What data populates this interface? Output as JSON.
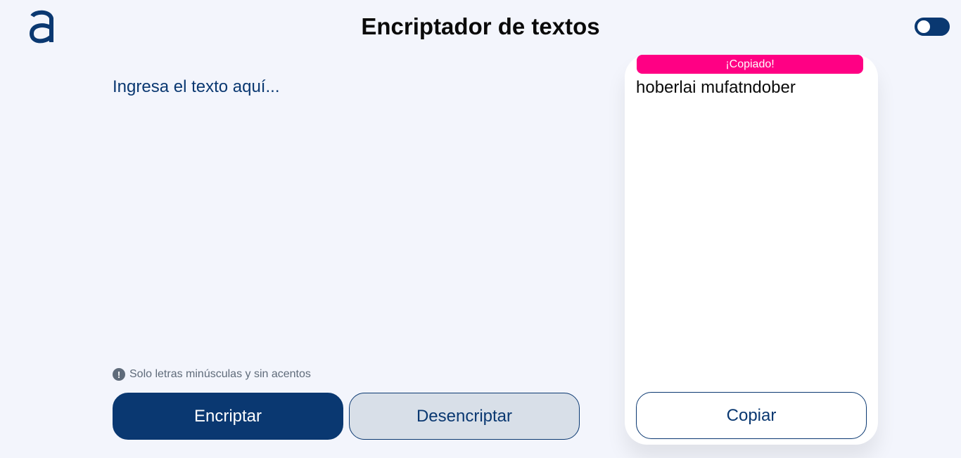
{
  "app": {
    "title": "Encriptador de textos"
  },
  "header": {
    "logo_icon": "alura-a-logo-icon",
    "toggle_icon": "theme-toggle-switch",
    "toggle_state": "off"
  },
  "input": {
    "placeholder": "Ingresa el texto aquí...",
    "value": ""
  },
  "hint": {
    "icon": "exclamation-circle-icon",
    "icon_glyph": "!",
    "text": "Solo letras minúsculas y sin acentos"
  },
  "buttons": {
    "encrypt_label": "Encriptar",
    "decrypt_label": "Desencriptar",
    "copy_label": "Copiar"
  },
  "output": {
    "copied_badge": "¡Copiado!",
    "text": "hoberlai mufatndober"
  },
  "colors": {
    "background": "#f3f5fc",
    "primary": "#0a3871",
    "secondary_button": "#d8dfe8",
    "badge": "#ff0084",
    "hint": "#5f6b7a"
  }
}
